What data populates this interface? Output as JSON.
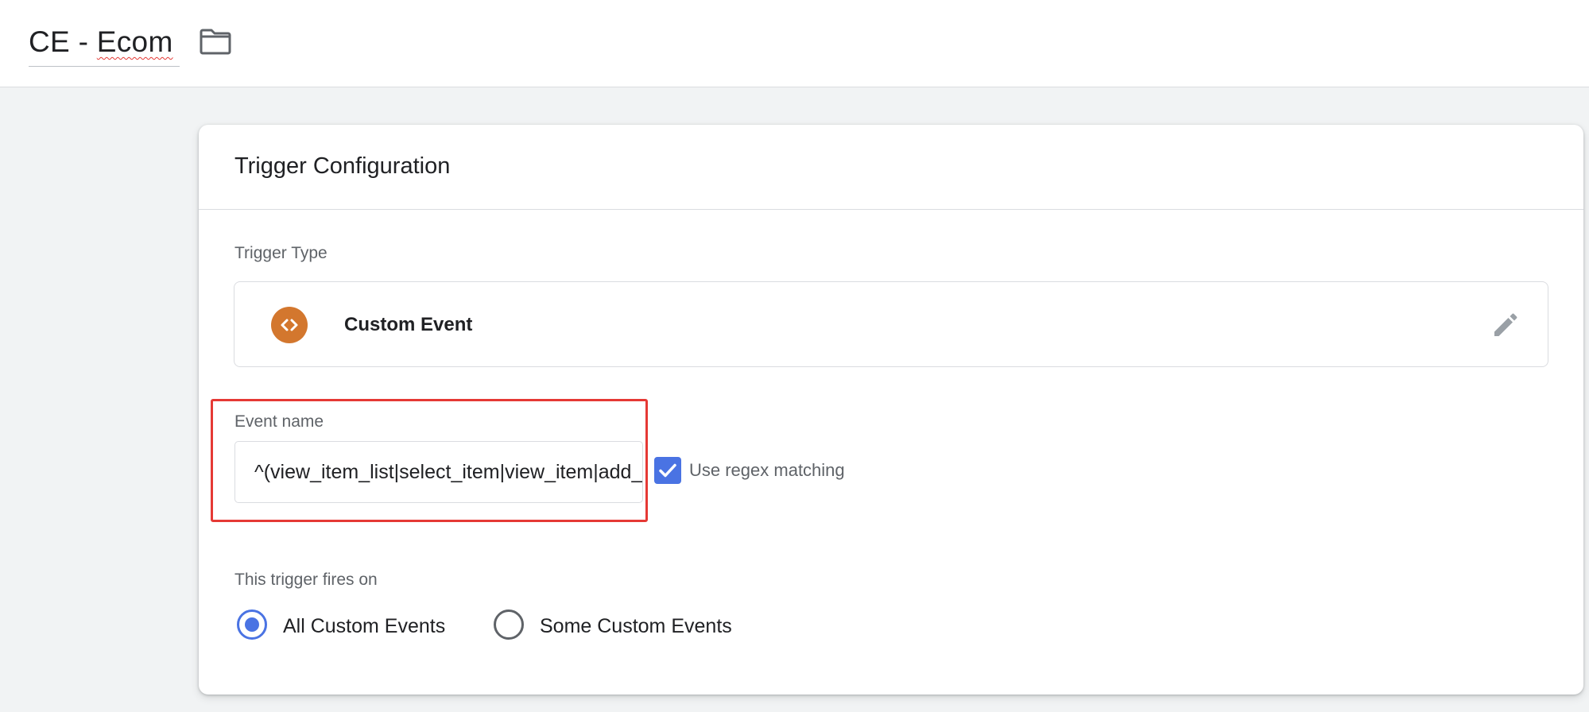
{
  "header": {
    "trigger_name": "CE - Ecom",
    "folder_icon": "folder-icon"
  },
  "card": {
    "title": "Trigger Configuration",
    "trigger_type": {
      "label": "Trigger Type",
      "value": "Custom Event",
      "icon": "code-brackets-icon",
      "icon_color": "#d3772e",
      "edit_icon": "pencil-icon"
    },
    "event_name": {
      "label": "Event name",
      "value": "^(view_item_list|select_item|view_item|add_to_cart",
      "highlight_color": "#e53935"
    },
    "regex": {
      "label": "Use regex matching",
      "checked": true,
      "color": "#4a73e3"
    },
    "fires_on": {
      "label": "This trigger fires on",
      "options": [
        {
          "label": "All Custom Events",
          "selected": true
        },
        {
          "label": "Some Custom Events",
          "selected": false
        }
      ]
    }
  }
}
